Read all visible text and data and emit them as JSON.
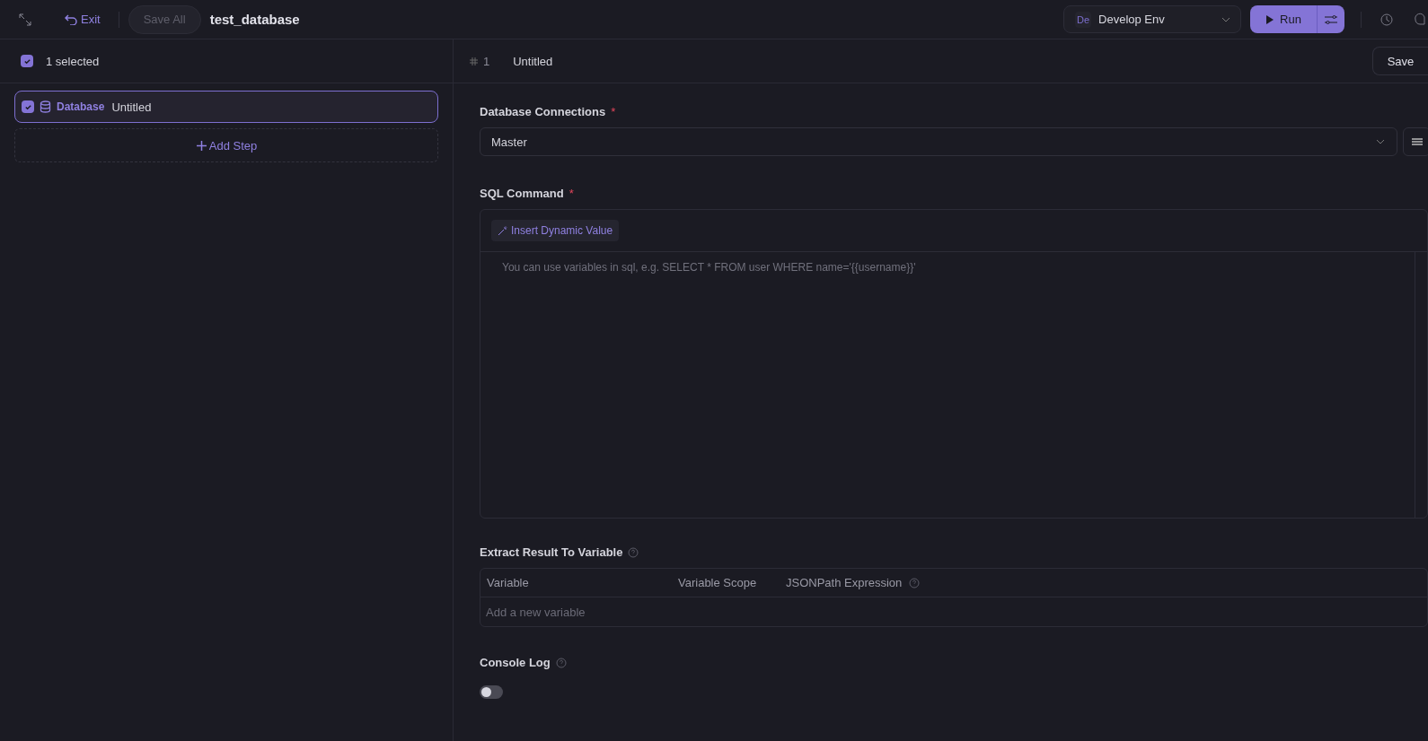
{
  "toolbar": {
    "exit": "Exit",
    "save_all": {
      "label": "Save All",
      "disabled": true
    },
    "title": "test_database",
    "env": {
      "badge": "De",
      "name": "Develop Env"
    },
    "run": "Run"
  },
  "sidebar": {
    "selection": {
      "checked": true,
      "label": "1 selected"
    },
    "steps": [
      {
        "checked": true,
        "selected": true,
        "kind": "database",
        "type": "Database",
        "name": "Untitled"
      }
    ],
    "add_step": "Add Step"
  },
  "editor": {
    "index": "1",
    "title": "Untitled",
    "save": "Save",
    "connections": {
      "label": "Database Connections",
      "required_mark": "*",
      "value": "Master"
    },
    "sql": {
      "label": "SQL Command",
      "required_mark": "*",
      "insert": "Insert Dynamic Value",
      "placeholder": "You can use variables in sql, e.g. SELECT * FROM user WHERE name='{{username}}'"
    },
    "extract": {
      "label": "Extract Result To Variable",
      "columns": [
        "Variable",
        "Variable Scope",
        "JSONPath Expression"
      ],
      "add_placeholder": "Add a new variable"
    },
    "console_log": {
      "label": "Console Log",
      "on": false
    }
  }
}
